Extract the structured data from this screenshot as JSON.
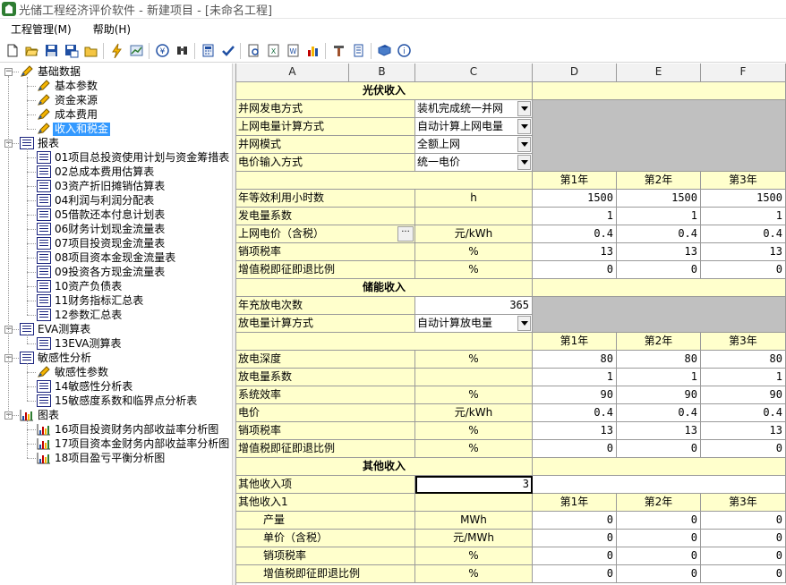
{
  "window": {
    "title": "光储工程经济评价软件 - 新建项目 - [未命名工程]"
  },
  "menu": [
    "工程管理(M)",
    "帮助(H)"
  ],
  "toolbar_icons": [
    "new-file-icon",
    "open-folder-icon",
    "save-icon",
    "save-as-icon",
    "folder-icon",
    "lightning-icon",
    "chart-icon",
    "currency-icon",
    "binoculars-icon",
    "calculator-icon",
    "check-icon",
    "preview-icon",
    "export-excel-icon",
    "export-word-icon",
    "bar-chart-icon",
    "tools-icon",
    "settings-icon",
    "book-icon",
    "info-icon"
  ],
  "tree": {
    "basic": {
      "label": "基础数据",
      "items": [
        "基本参数",
        "资金来源",
        "成本费用",
        "收入和税金"
      ]
    },
    "reports": {
      "label": "报表",
      "items": [
        "01项目总投资使用计划与资金筹措表",
        "02总成本费用估算表",
        "03资产折旧摊销估算表",
        "04利润与利润分配表",
        "05借款还本付息计划表",
        "06财务计划现金流量表",
        "07项目投资现金流量表",
        "08项目资本金现金流量表",
        "09投资各方现金流量表",
        "10资产负债表",
        "11财务指标汇总表",
        "12参数汇总表"
      ]
    },
    "eva": {
      "label": "EVA测算表",
      "items": [
        "13EVA测算表"
      ]
    },
    "sens": {
      "label": "敏感性分析",
      "items": [
        "敏感性参数",
        "14敏感性分析表",
        "15敏感度系数和临界点分析表"
      ]
    },
    "charts": {
      "label": "图表",
      "items": [
        "16项目投资财务内部收益率分析图",
        "17项目资本金财务内部收益率分析图",
        "18项目盈亏平衡分析图"
      ]
    }
  },
  "grid": {
    "cols": [
      "A",
      "B",
      "C",
      "D",
      "E",
      "F"
    ],
    "years": [
      "第1年",
      "第2年",
      "第3年"
    ],
    "pv": {
      "title": "光伏收入",
      "settings": [
        {
          "label": "并网发电方式",
          "value": "装机完成统一并网"
        },
        {
          "label": "上网电量计算方式",
          "value": "自动计算上网电量"
        },
        {
          "label": "并网模式",
          "value": "全额上网"
        },
        {
          "label": "电价输入方式",
          "value": "统一电价"
        }
      ],
      "rows": [
        {
          "label": "年等效利用小时数",
          "unit": "h",
          "v": [
            "1500",
            "1500",
            "1500"
          ]
        },
        {
          "label": "发电量系数",
          "unit": "",
          "v": [
            "1",
            "1",
            "1"
          ]
        },
        {
          "label": "上网电价（含税）",
          "unit": "元/kWh",
          "v": [
            "0.4",
            "0.4",
            "0.4"
          ]
        },
        {
          "label": "销项税率",
          "unit": "%",
          "v": [
            "13",
            "13",
            "13"
          ]
        },
        {
          "label": "增值税即征即退比例",
          "unit": "%",
          "v": [
            "0",
            "0",
            "0"
          ]
        }
      ]
    },
    "storage": {
      "title": "储能收入",
      "cycles_label": "年充放电次数",
      "cycles_value": "365",
      "method_label": "放电量计算方式",
      "method_value": "自动计算放电量",
      "rows": [
        {
          "label": "放电深度",
          "unit": "%",
          "v": [
            "80",
            "80",
            "80"
          ]
        },
        {
          "label": "放电量系数",
          "unit": "",
          "v": [
            "1",
            "1",
            "1"
          ]
        },
        {
          "label": "系统效率",
          "unit": "%",
          "v": [
            "90",
            "90",
            "90"
          ]
        },
        {
          "label": "电价",
          "unit": "元/kWh",
          "v": [
            "0.4",
            "0.4",
            "0.4"
          ]
        },
        {
          "label": "销项税率",
          "unit": "%",
          "v": [
            "13",
            "13",
            "13"
          ]
        },
        {
          "label": "增值税即征即退比例",
          "unit": "%",
          "v": [
            "0",
            "0",
            "0"
          ]
        }
      ]
    },
    "other": {
      "title": "其他收入",
      "count_label": "其他收入项",
      "count_value": "3",
      "item_label": "其他收入1",
      "rows": [
        {
          "label": "产量",
          "unit": "MWh",
          "v": [
            "0",
            "0",
            "0"
          ]
        },
        {
          "label": "单价（含税）",
          "unit": "元/MWh",
          "v": [
            "0",
            "0",
            "0"
          ]
        },
        {
          "label": "销项税率",
          "unit": "%",
          "v": [
            "0",
            "0",
            "0"
          ]
        },
        {
          "label": "增值税即征即退比例",
          "unit": "%",
          "v": [
            "0",
            "0",
            "0"
          ]
        }
      ]
    }
  }
}
